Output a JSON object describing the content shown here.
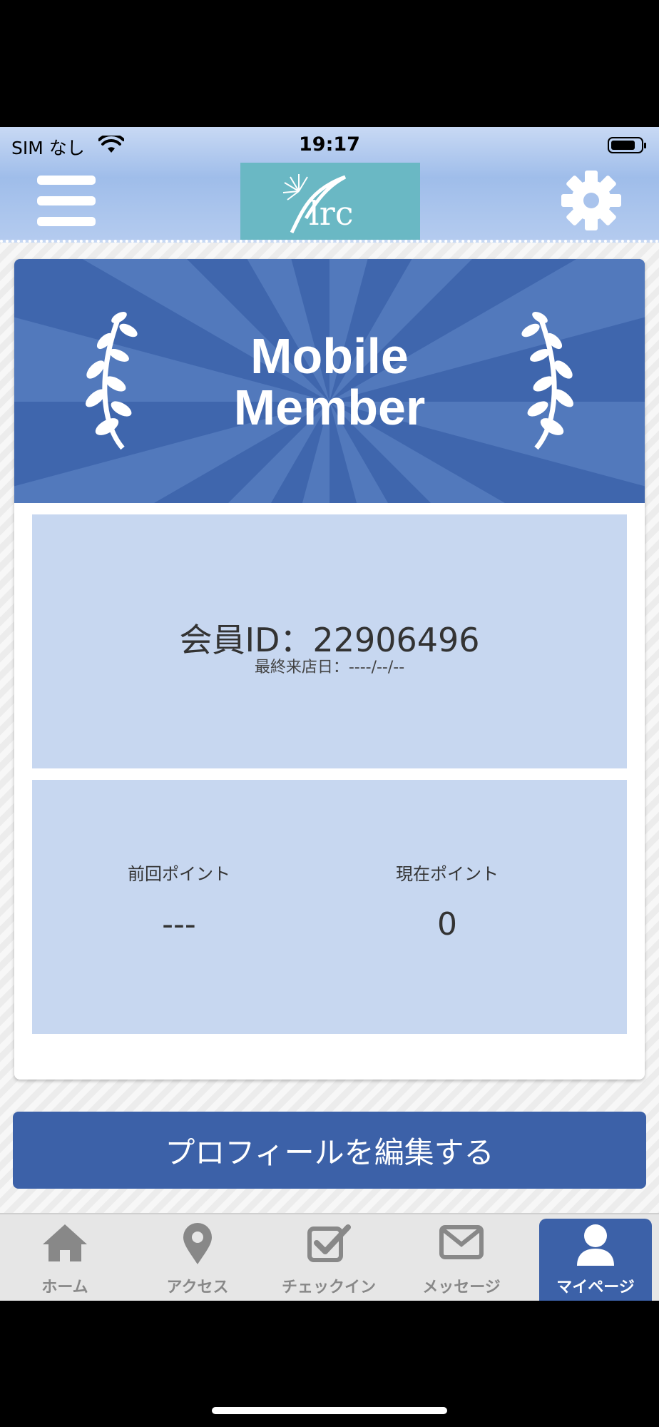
{
  "status_bar": {
    "carrier": "SIM なし",
    "time": "19:17"
  },
  "header": {
    "logo_text": "lrc"
  },
  "banner": {
    "title_line1": "Mobile",
    "title_line2": "Member"
  },
  "member": {
    "id_text": "会員ID：22906496",
    "last_visit": "最終来店日：----/--/--"
  },
  "points": {
    "previous_label": "前回ポイント",
    "previous_value": "---",
    "current_label": "現在ポイント",
    "current_value": "0"
  },
  "edit_profile_label": "プロフィールを編集する",
  "tabs": [
    {
      "label": "ホーム",
      "icon": "home-icon"
    },
    {
      "label": "アクセス",
      "icon": "map-pin-icon"
    },
    {
      "label": "チェックイン",
      "icon": "checkbox-icon"
    },
    {
      "label": "メッセージ",
      "icon": "envelope-icon"
    },
    {
      "label": "マイページ",
      "icon": "user-icon",
      "active": true
    }
  ],
  "colors": {
    "primary": "#3c61a8",
    "panel": "#c7d7f0",
    "logo_bg": "#6ab8c4"
  }
}
